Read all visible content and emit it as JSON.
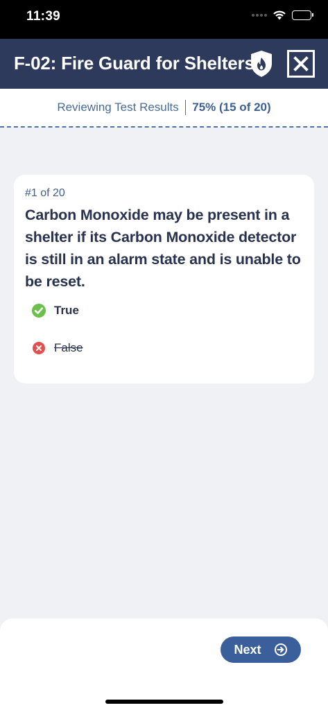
{
  "status_bar": {
    "time": "11:39",
    "icons": [
      "cellular-icon",
      "wifi-icon",
      "battery-icon"
    ]
  },
  "header": {
    "title": "F-02: Fire Guard for Shelters",
    "shield_icon": "fire-shield-icon",
    "close_icon": "close-icon",
    "background_color": "#2d3a5c"
  },
  "results": {
    "label": "Reviewing Test Results",
    "score": "75% (15 of 20)"
  },
  "question": {
    "counter": "#1 of 20",
    "text": "Carbon Monoxide may be present in a shelter if its Carbon Monoxide detector is still in an alarm state and is unable to be reset.",
    "answers": [
      {
        "label": "True",
        "status": "correct",
        "icon": "check-circle-icon",
        "color": "#6dbf4b"
      },
      {
        "label": "False",
        "status": "incorrect",
        "icon": "x-circle-icon",
        "color": "#e0514f"
      }
    ]
  },
  "footer": {
    "next_label": "Next",
    "next_icon": "arrow-right-circle-icon",
    "accent_color": "#3a5f9a"
  }
}
